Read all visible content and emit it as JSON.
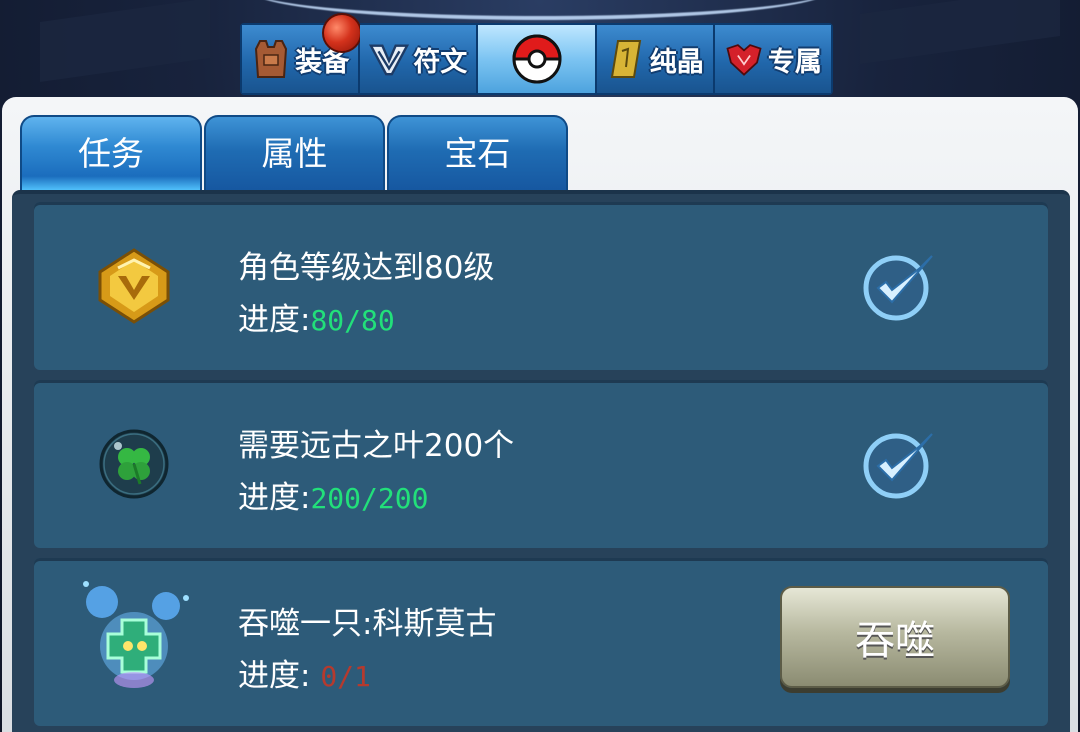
{
  "category_bar": {
    "items": [
      {
        "label": "装备",
        "icon": "vest-icon"
      },
      {
        "label": "符文",
        "icon": "rune-icon"
      },
      {
        "label": "",
        "icon": "pokeball-icon"
      },
      {
        "label": "纯晶",
        "icon": "crystal-icon"
      },
      {
        "label": "专属",
        "icon": "exclusive-armor-icon"
      }
    ],
    "active_index": 2
  },
  "tabs": [
    {
      "label": "任务"
    },
    {
      "label": "属性"
    },
    {
      "label": "宝石"
    }
  ],
  "active_tab": 0,
  "tasks": [
    {
      "title": "角色等级达到80级",
      "progress_label": "进度:",
      "progress_value": "80/80",
      "progress_color": "#22e07a",
      "icon": "gold-level-badge-icon",
      "status": "completed"
    },
    {
      "title": "需要远古之叶200个",
      "progress_label": "进度:",
      "progress_value": "200/200",
      "progress_color": "#22e07a",
      "icon": "clover-leaf-icon",
      "status": "completed"
    },
    {
      "title": "吞噬一只:科斯莫古",
      "progress_label": "进度: ",
      "progress_value": "0/1",
      "progress_color": "#b53a2e",
      "icon": "cosmog-creature-icon",
      "status": "pending",
      "button_label": "吞噬"
    }
  ],
  "colors": {
    "tab_blue": "#2f89d2",
    "row_bg": "#2d5b79",
    "complete_green": "#22e07a",
    "incomplete_red": "#b53a2e"
  }
}
